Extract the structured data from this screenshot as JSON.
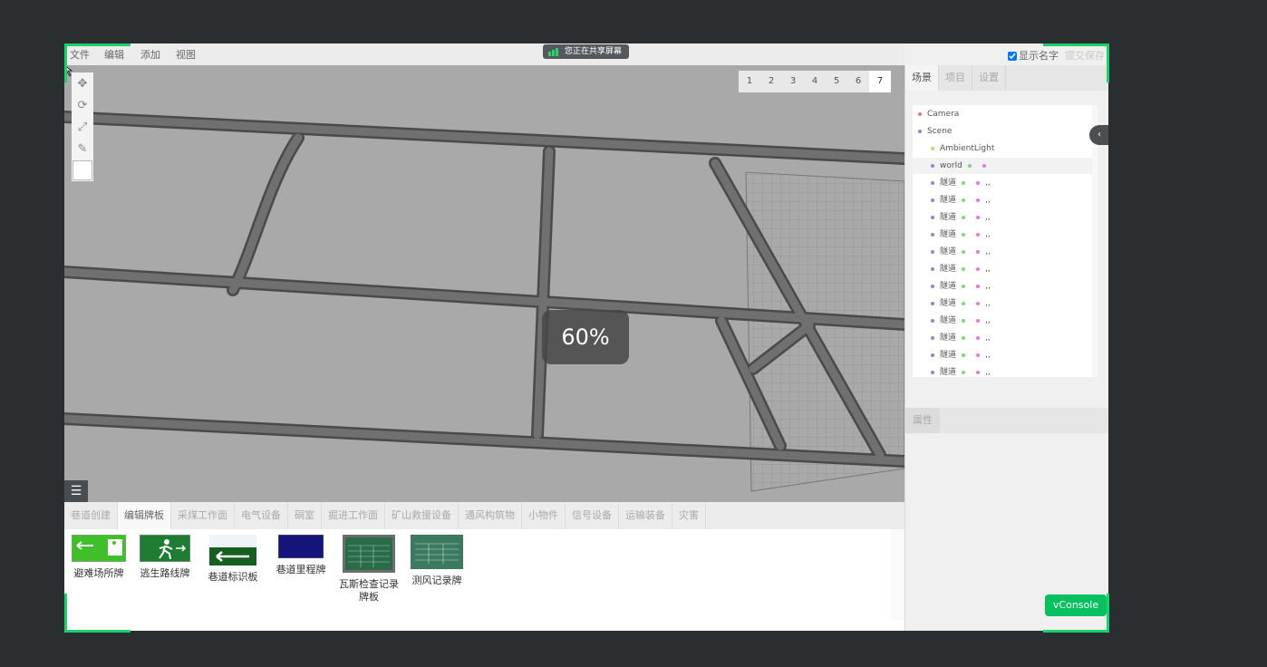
{
  "menu": {
    "file": "文件",
    "edit": "编辑",
    "add": "添加",
    "view": "视图"
  },
  "share_banner": {
    "text": "您正在共享屏幕"
  },
  "header_right": {
    "show_names_label": "显示名字",
    "show_names_checked": true,
    "submit_save": "提交保存"
  },
  "pages": [
    "1",
    "2",
    "3",
    "4",
    "5",
    "6",
    "7"
  ],
  "active_page": "7",
  "progress": {
    "label": "60%",
    "value": 0.6
  },
  "toolbox": {
    "icons": [
      "move-icon",
      "rotate-icon",
      "scale-icon",
      "measure-icon",
      "color-swatch"
    ]
  },
  "categories": [
    "巷道创建",
    "编辑牌板",
    "采煤工作面",
    "电气设备",
    "硐室",
    "掘进工作面",
    "矿山救援设备",
    "通风构筑物",
    "小物件",
    "信号设备",
    "运输装备",
    "灾害"
  ],
  "active_category": "编辑牌板",
  "assets": [
    {
      "name": "避难场所牌"
    },
    {
      "name": "逃生路线牌"
    },
    {
      "name": "巷道标识板"
    },
    {
      "name": "巷道里程牌"
    },
    {
      "name": "瓦斯检查记录牌板"
    },
    {
      "name": "测风记录牌"
    }
  ],
  "right_tabs": [
    "场景",
    "项目",
    "设置"
  ],
  "active_right_tab": "场景",
  "scene_tree": [
    {
      "label": "Camera",
      "color": "#e07a7a",
      "indent": 0
    },
    {
      "label": "Scene",
      "color": "#9a7fd6",
      "indent": 0
    },
    {
      "label": "AmbientLight",
      "color": "#c6d67a",
      "indent": 1
    },
    {
      "label": "world",
      "color": "#9a7fd6",
      "indent": 1,
      "selected": true
    },
    {
      "label": "隧道",
      "color": "#9a7fd6",
      "indent": 1
    },
    {
      "label": "隧道",
      "color": "#9a7fd6",
      "indent": 1
    },
    {
      "label": "隧道",
      "color": "#9a7fd6",
      "indent": 1
    },
    {
      "label": "隧道",
      "color": "#9a7fd6",
      "indent": 1
    },
    {
      "label": "隧道",
      "color": "#9a7fd6",
      "indent": 1
    },
    {
      "label": "隧道",
      "color": "#9a7fd6",
      "indent": 1
    },
    {
      "label": "隧道",
      "color": "#9a7fd6",
      "indent": 1
    },
    {
      "label": "隧道",
      "color": "#9a7fd6",
      "indent": 1
    },
    {
      "label": "隧道",
      "color": "#9a7fd6",
      "indent": 1
    },
    {
      "label": "隧道",
      "color": "#9a7fd6",
      "indent": 1
    },
    {
      "label": "隧道",
      "color": "#9a7fd6",
      "indent": 1
    },
    {
      "label": "隧道",
      "color": "#9a7fd6",
      "indent": 1
    }
  ],
  "row_suffix": ",,",
  "properties_tab": "属性",
  "vconsole": "vConsole",
  "colors": {
    "accent_green": "#19d26a",
    "vconsole_green": "#07c160",
    "viewport_bg": "#a9a9a9",
    "tunnel": "#6f6f6f"
  }
}
